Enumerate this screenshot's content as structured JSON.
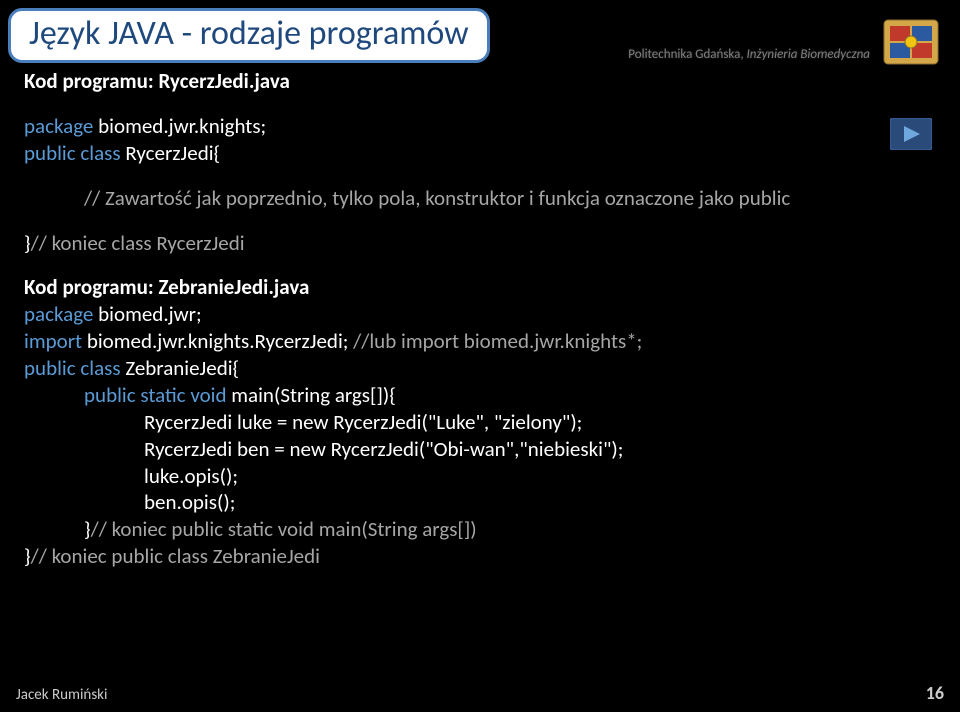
{
  "title": "Język JAVA - rodzaje programów",
  "headerRight": {
    "plain": "Politechnika Gdańska, ",
    "italic": "Inżynieria Biomedyczna"
  },
  "subtitle1": "Kod programu: RycerzJedi.java",
  "pkg1a": "package ",
  "pkg1b": "biomed.jwr.knights;",
  "cls1a": "public class ",
  "cls1b": "RycerzJedi{",
  "comment1": "// Zawartość jak poprzednio, tylko pola, konstruktor i funkcja oznaczone jako public",
  "end1a": "}",
  "end1b": "// koniec class RycerzJedi",
  "subtitle2": "Kod programu: ZebranieJedi.java",
  "pkg2a": "package ",
  "pkg2b": "biomed.jwr;",
  "imp2a": "import ",
  "imp2b": "biomed.jwr.knights.RycerzJedi; ",
  "imp2c": "//lub import biomed.jwr.knights*;",
  "cls2a": "public class ",
  "cls2b": "ZebranieJedi{",
  "main1": "public static void ",
  "main2": "main(String args[]){",
  "line1": "RycerzJedi luke = new RycerzJedi(\"Luke\", \"zielony\");",
  "line2": "RycerzJedi ben = new RycerzJedi(\"Obi-wan\",\"niebieski\");",
  "line3": "luke.opis();",
  "line4": "ben.opis();",
  "endMainA": "}",
  "endMainB": "// koniec public static void main(String args[])",
  "endCls2A": "}",
  "endCls2B": "// koniec public class  ZebranieJedi",
  "footerLeft": "Jacek Rumiński",
  "footerRight": "16"
}
